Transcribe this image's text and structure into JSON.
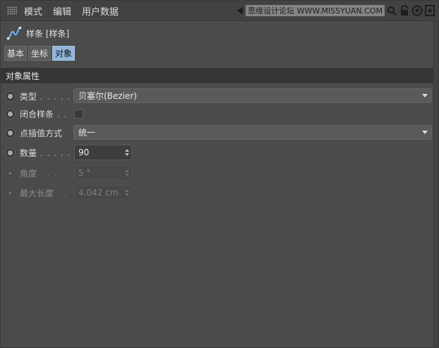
{
  "menubar": {
    "items": [
      "模式",
      "编辑",
      "用户数据"
    ],
    "watermark": "思缘设计论坛 WWW.MISSYUAN.COM"
  },
  "object": {
    "title": "样条 [样条]",
    "icon": "spline-icon"
  },
  "tabs": [
    {
      "label": "基本",
      "active": false
    },
    {
      "label": "坐标",
      "active": false
    },
    {
      "label": "对象",
      "active": true
    }
  ],
  "section": {
    "title": "对象属性"
  },
  "properties": {
    "type": {
      "label": "类型",
      "dots": " . . . . .",
      "value": "贝塞尔(Bezier)"
    },
    "close_spline": {
      "label": "闭合样条",
      "dots": " . .",
      "checked": false
    },
    "interpolation": {
      "label": "点插值方式",
      "value": "统一"
    },
    "number": {
      "label": "数量",
      "dots": " . . . . .",
      "value": "90"
    },
    "angle": {
      "label": "角度",
      "dots": " . . . . .",
      "value": "5 °"
    },
    "max_length": {
      "label": "最大长度",
      "dots": " . .",
      "value": "4.042 cm"
    }
  },
  "colors": {
    "background": "#4b4b4b",
    "active_tab": "#92b6dc",
    "section_header": "#353535"
  }
}
